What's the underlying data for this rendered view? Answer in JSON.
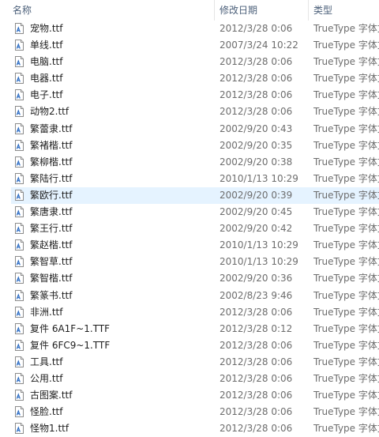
{
  "columns": {
    "name": "名称",
    "date": "修改日期",
    "type": "类型"
  },
  "colors": {
    "header_text": "#4c607a",
    "hover_row": "#e5f3ff",
    "meta_text": "#6d6d6d"
  },
  "hover_index": 10,
  "files": [
    {
      "name": "宠物.ttf",
      "date": "2012/3/28 0:06",
      "type": "TrueType 字体文件"
    },
    {
      "name": "单线.ttf",
      "date": "2007/3/24 10:22",
      "type": "TrueType 字体文件"
    },
    {
      "name": "电脑.ttf",
      "date": "2012/3/28 0:06",
      "type": "TrueType 字体文件"
    },
    {
      "name": "电器.ttf",
      "date": "2012/3/28 0:06",
      "type": "TrueType 字体文件"
    },
    {
      "name": "电子.ttf",
      "date": "2012/3/28 0:06",
      "type": "TrueType 字体文件"
    },
    {
      "name": "动物2.ttf",
      "date": "2012/3/28 0:06",
      "type": "TrueType 字体文件"
    },
    {
      "name": "繁蕾隶.ttf",
      "date": "2002/9/20 0:43",
      "type": "TrueType 字体文件"
    },
    {
      "name": "繁褚楷.ttf",
      "date": "2002/9/20 0:35",
      "type": "TrueType 字体文件"
    },
    {
      "name": "繁柳楷.ttf",
      "date": "2002/9/20 0:38",
      "type": "TrueType 字体文件"
    },
    {
      "name": "繁陆行.ttf",
      "date": "2010/1/13 10:29",
      "type": "TrueType 字体文件"
    },
    {
      "name": "繁欧行.ttf",
      "date": "2002/9/20 0:39",
      "type": "TrueType 字体文件"
    },
    {
      "name": "繁唐隶.ttf",
      "date": "2002/9/20 0:45",
      "type": "TrueType 字体文件"
    },
    {
      "name": "繁王行.ttf",
      "date": "2002/9/20 0:42",
      "type": "TrueType 字体文件"
    },
    {
      "name": "繁赵楷.ttf",
      "date": "2010/1/13 10:29",
      "type": "TrueType 字体文件"
    },
    {
      "name": "繁智草.ttf",
      "date": "2010/1/13 10:29",
      "type": "TrueType 字体文件"
    },
    {
      "name": "繁智楷.ttf",
      "date": "2002/9/20 0:36",
      "type": "TrueType 字体文件"
    },
    {
      "name": "繁篆书.ttf",
      "date": "2002/8/23 9:46",
      "type": "TrueType 字体文件"
    },
    {
      "name": "非洲.ttf",
      "date": "2012/3/28 0:06",
      "type": "TrueType 字体文件"
    },
    {
      "name": "复件 6A1F~1.TTF",
      "date": "2012/3/28 0:12",
      "type": "TrueType 字体文件"
    },
    {
      "name": "复件 6FC9~1.TTF",
      "date": "2012/3/28 0:06",
      "type": "TrueType 字体文件"
    },
    {
      "name": "工具.ttf",
      "date": "2012/3/28 0:06",
      "type": "TrueType 字体文件"
    },
    {
      "name": "公用.ttf",
      "date": "2012/3/28 0:06",
      "type": "TrueType 字体文件"
    },
    {
      "name": "古图案.ttf",
      "date": "2012/3/28 0:06",
      "type": "TrueType 字体文件"
    },
    {
      "name": "怪脸.ttf",
      "date": "2012/3/28 0:06",
      "type": "TrueType 字体文件"
    },
    {
      "name": "怪物1.ttf",
      "date": "2012/3/28 0:06",
      "type": "TrueType 字体文件"
    }
  ]
}
